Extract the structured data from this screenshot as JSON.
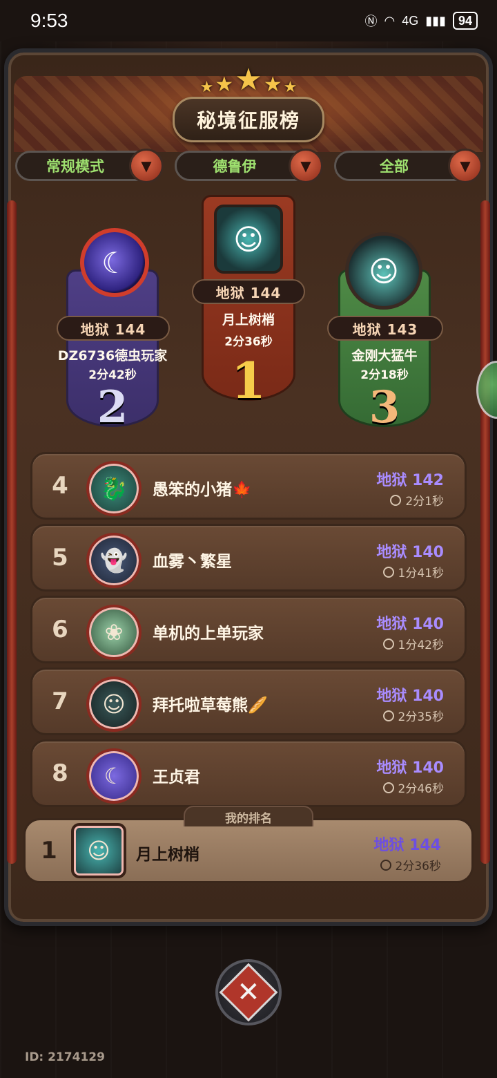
{
  "status_bar": {
    "time": "9:53",
    "network": "4G",
    "battery": "94"
  },
  "header": {
    "title": "秘境征服榜",
    "stars": [
      "★",
      "★",
      "★",
      "★",
      "★"
    ]
  },
  "filters": [
    {
      "label": "常规模式"
    },
    {
      "label": "德鲁伊"
    },
    {
      "label": "全部"
    }
  ],
  "podium": {
    "first": {
      "rank": "1",
      "level": "地狱 144",
      "name": "月上树梢",
      "time": "2分36秒",
      "icon": "clown-avatar"
    },
    "second": {
      "rank": "2",
      "level": "地狱 144",
      "name": "DZ6736德虫玩家",
      "time": "2分42秒",
      "icon": "moon-orb-avatar"
    },
    "third": {
      "rank": "3",
      "level": "地狱 143",
      "name": "金刚大猛牛",
      "time": "2分18秒",
      "icon": "clown-hat-avatar"
    }
  },
  "leaderboard": [
    {
      "rank": "4",
      "name": "愚笨的小猪🍁",
      "level": "地狱 142",
      "time": "2分1秒",
      "icon": "dragon-avatar"
    },
    {
      "rank": "5",
      "name": "血雾丶繁星",
      "level": "地狱 140",
      "time": "1分41秒",
      "icon": "ghost-avatar"
    },
    {
      "rank": "6",
      "name": "单机的上单玩家",
      "level": "地狱 140",
      "time": "1分42秒",
      "icon": "spirit-avatar"
    },
    {
      "rank": "7",
      "name": "拜托啦草莓熊🥖",
      "level": "地狱 140",
      "time": "2分35秒",
      "icon": "clown-avatar"
    },
    {
      "rank": "8",
      "name": "王贞君",
      "level": "地狱 140",
      "time": "2分46秒",
      "icon": "moon-orb-avatar"
    }
  ],
  "my_rank": {
    "tab_label": "我的排名",
    "rank": "1",
    "name": "月上树梢",
    "level": "地狱 144",
    "time": "2分36秒",
    "icon": "clown-avatar"
  },
  "footer": {
    "player_id": "ID: 2174129"
  },
  "colors": {
    "level_text": "#a98cff",
    "filter_text": "#9ee06f",
    "gold": "#f6cc4a"
  }
}
